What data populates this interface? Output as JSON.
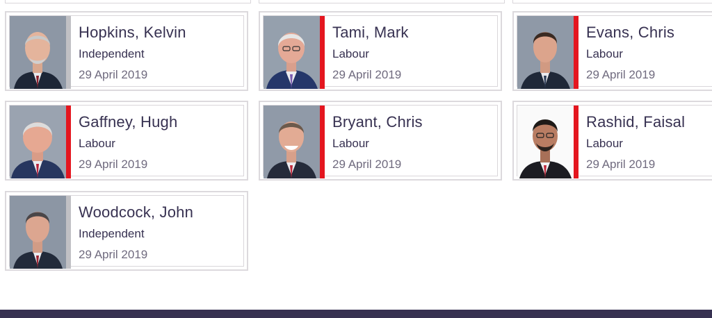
{
  "colors": {
    "labour": "#e4161f",
    "independent": "#c0c0c4",
    "footer": "#373151"
  },
  "members": [
    {
      "name": "Hopkins, Kelvin",
      "party": "Independent",
      "date": "29 April 2019",
      "party_color": "#c0c0c4"
    },
    {
      "name": "Tami, Mark",
      "party": "Labour",
      "date": "29 April 2019",
      "party_color": "#e4161f"
    },
    {
      "name": "Evans, Chris",
      "party": "Labour",
      "date": "29 April 2019",
      "party_color": "#e4161f"
    },
    {
      "name": "Gaffney, Hugh",
      "party": "Labour",
      "date": "29 April 2019",
      "party_color": "#e4161f"
    },
    {
      "name": "Bryant, Chris",
      "party": "Labour",
      "date": "29 April 2019",
      "party_color": "#e4161f"
    },
    {
      "name": "Rashid, Faisal",
      "party": "Labour",
      "date": "29 April 2019",
      "party_color": "#e4161f"
    },
    {
      "name": "Woodcock, John",
      "party": "Independent",
      "date": "29 April 2019",
      "party_color": "#c0c0c4"
    }
  ]
}
